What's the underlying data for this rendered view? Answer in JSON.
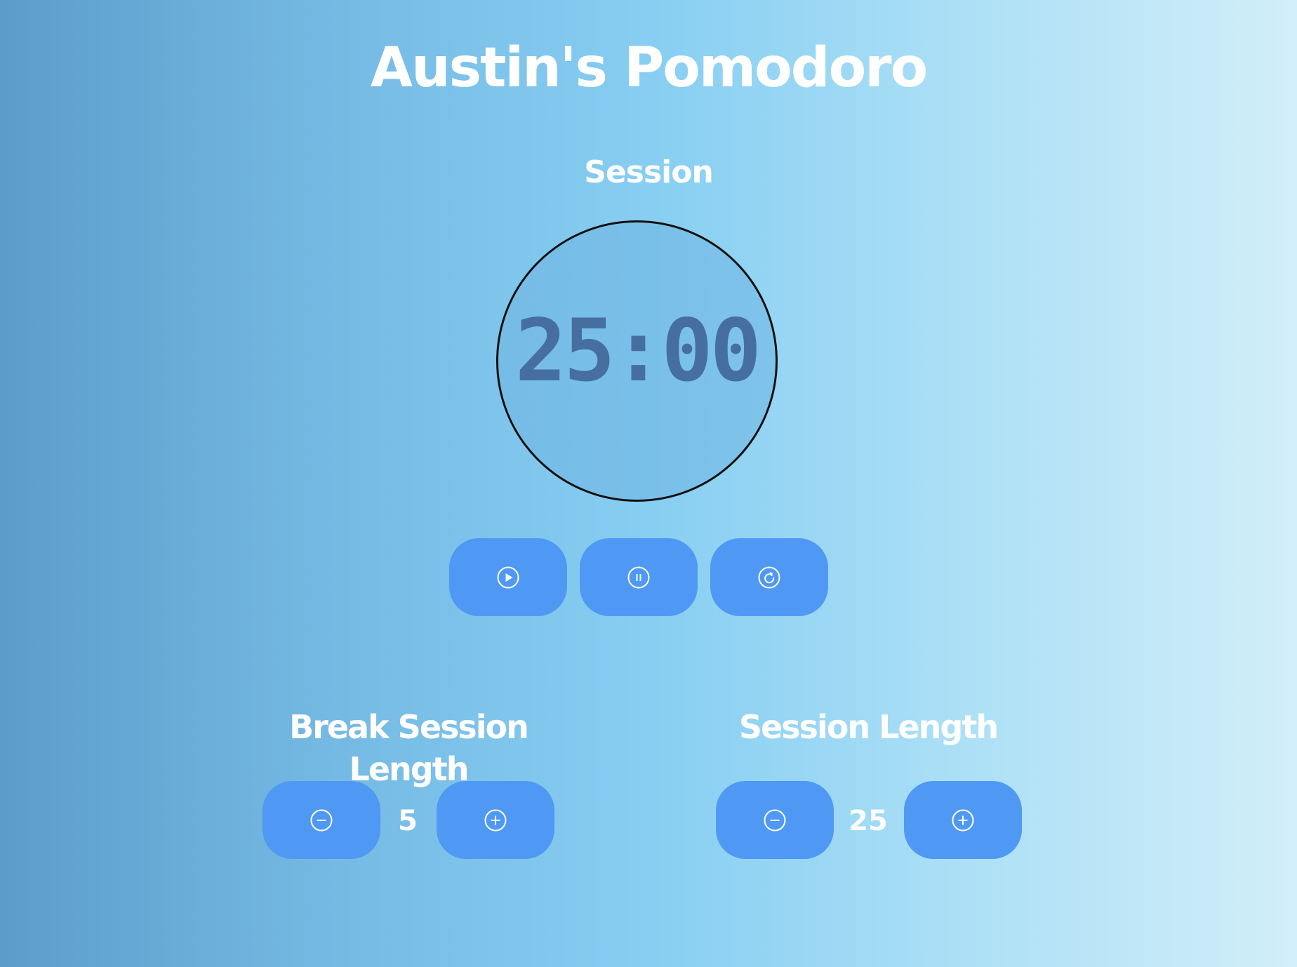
{
  "app": {
    "title": "Austin's Pomodoro"
  },
  "timer": {
    "mode_label": "Session",
    "display": "25:00"
  },
  "controls": {
    "play_icon": "play-circle-icon",
    "pause_icon": "pause-circle-icon",
    "reset_icon": "refresh-circle-icon"
  },
  "break_length": {
    "label": "Break Session Length",
    "value": "5",
    "decrement_icon": "minus-circle-icon",
    "increment_icon": "plus-circle-icon"
  },
  "session_length": {
    "label": "Session Length",
    "value": "25",
    "decrement_icon": "minus-circle-icon",
    "increment_icon": "plus-circle-icon"
  },
  "colors": {
    "button": "#4f99f5",
    "timer_text": "#466fa0",
    "background_start": "#5c9ccb",
    "background_end": "#d2eef9"
  }
}
